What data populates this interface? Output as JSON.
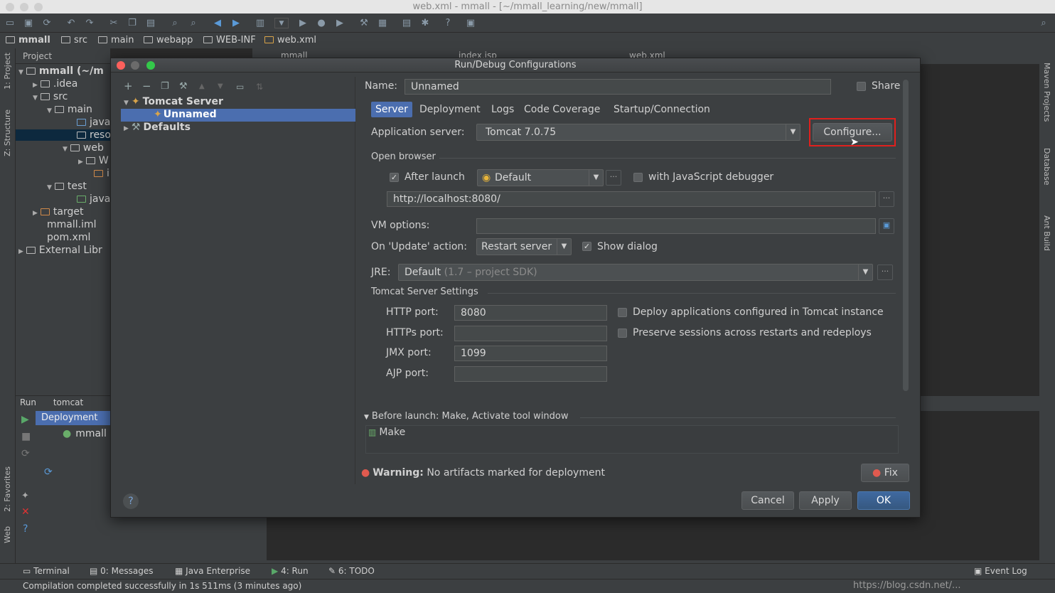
{
  "window": {
    "title": "web.xml - mmall - [~/mmall_learning/new/mmall]"
  },
  "breadcrumbs": [
    "mmall",
    "src",
    "main",
    "webapp",
    "WEB-INF",
    "web.xml"
  ],
  "side_tools": {
    "project": "1: Project",
    "structure": "Z: Structure",
    "favorites": "2: Favorites",
    "web": "Web",
    "maven": "Maven Projects",
    "database": "Database",
    "ant": "Ant Build"
  },
  "project_panel": {
    "header": "Project",
    "items": [
      "mmall (~/m",
      ".idea",
      "src",
      "main",
      "java",
      "reso",
      "web",
      "W",
      "i",
      "test",
      "java",
      "target",
      "mmall.iml",
      "pom.xml",
      "External Libr"
    ]
  },
  "editor_tabs": [
    "mmall",
    "index.jsp",
    "web.xml"
  ],
  "run_panel": {
    "label": "Run",
    "config": "tomcat",
    "deployment_label": "Deployment",
    "artifact": "mmall"
  },
  "bottom_tabs": [
    "Terminal",
    "0: Messages",
    "Java Enterprise",
    "4: Run",
    "6: TODO",
    "Event Log"
  ],
  "status": {
    "text": "Compilation completed successfully in 1s 511ms (3 minutes ago)"
  },
  "watermark": "https://blog.csdn.net/...",
  "dialog": {
    "title": "Run/Debug Configurations",
    "tree": {
      "tomcat": "Tomcat Server",
      "selected": "Unnamed",
      "defaults": "Defaults"
    },
    "name_label": "Name:",
    "name_value": "Unnamed",
    "share_label": "Share",
    "tabs": [
      "Server",
      "Deployment",
      "Logs",
      "Code Coverage",
      "Startup/Connection"
    ],
    "app_server_label": "Application server:",
    "app_server_value": "Tomcat 7.0.75",
    "configure_label": "Configure...",
    "open_browser_label": "Open browser",
    "after_launch_label": "After launch",
    "browser_value": "Default",
    "js_debugger_label": "with JavaScript debugger",
    "url_value": "http://localhost:8080/",
    "vm_options_label": "VM options:",
    "update_action_label": "On 'Update' action:",
    "update_action_value": "Restart server",
    "show_dialog_label": "Show dialog",
    "jre_label": "JRE:",
    "jre_value": "Default",
    "jre_hint": "(1.7 – project SDK)",
    "tomcat_settings_label": "Tomcat Server Settings",
    "http_port_label": "HTTP port:",
    "http_port_value": "8080",
    "https_port_label": "HTTPs port:",
    "https_port_value": "",
    "jmx_port_label": "JMX port:",
    "jmx_port_value": "1099",
    "ajp_port_label": "AJP port:",
    "ajp_port_value": "",
    "deploy_apps_label": "Deploy applications configured in Tomcat instance",
    "preserve_sessions_label": "Preserve sessions across restarts and redeploys",
    "before_launch_label": "Before launch: Make, Activate tool window",
    "make_label": "Make",
    "warning_bold": "Warning:",
    "warning_text": "No artifacts marked for deployment",
    "fix_label": "Fix",
    "cancel_label": "Cancel",
    "apply_label": "Apply",
    "ok_label": "OK",
    "help_label": "?"
  },
  "colors": {
    "highlight_border": "#e0201d",
    "selection": "#4b6eaf",
    "ok_button": "#365880"
  }
}
